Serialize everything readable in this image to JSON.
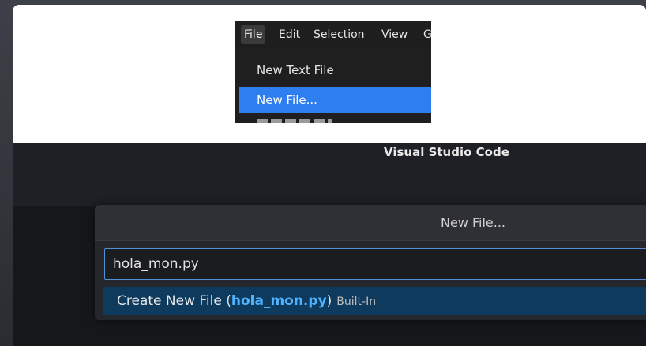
{
  "menu": {
    "bar": [
      "File",
      "Edit",
      "Selection",
      "View",
      "G"
    ],
    "items": [
      "New Text File",
      "New File...",
      "New Window"
    ],
    "selected_index": 1
  },
  "window": {
    "title": "Visual Studio Code"
  },
  "quick_pick": {
    "title": "New File...",
    "input_value": "hola_mon.py",
    "result": {
      "prefix": "Create New File (",
      "highlight": "hola_mon.py",
      "suffix": ")",
      "description": "Built-In"
    }
  },
  "colors": {
    "selection": "#2f7ef0",
    "focus_border": "#4f8fd6",
    "highlight_text": "#4fb3ff",
    "result_background": "#0e3a5e"
  }
}
